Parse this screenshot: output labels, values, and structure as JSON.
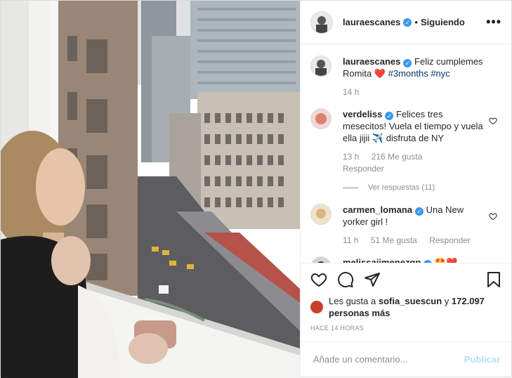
{
  "post": {
    "username": "lauraescanes",
    "follow_sep": "•",
    "follow_label": "Siguiendo",
    "more_label": "•••"
  },
  "caption": {
    "username": "lauraescanes",
    "text": "Feliz cumplemes Romita",
    "emoji": "❤️",
    "tags": "#3months #nyc",
    "time": "14 h"
  },
  "comments": [
    {
      "username": "verdeliss",
      "text": "Felices tres mesecitos! Vuela el tiempo y vuela ella jijii",
      "emoji": "✈️",
      "text2": "disfruta de NY",
      "time": "13 h",
      "likes": "216 Me gusta",
      "reply": "Responder",
      "view_replies": "Ver respuestas (11)"
    },
    {
      "username": "carmen_lomana",
      "text": "Una New yorker girl !",
      "time": "11 h",
      "likes": "51 Me gusta",
      "reply": "Responder"
    },
    {
      "username": "melissajimenezgp",
      "text": "🤩❤️"
    }
  ],
  "likes": {
    "prefix": "Les gusta a",
    "user": "sofia_suescun",
    "suffix": "y",
    "count": "172.097 personas más"
  },
  "posted_ago": "HACE 14 HORAS",
  "add_comment": {
    "placeholder": "Añade un comentario...",
    "publish": "Publicar"
  },
  "colors": {
    "verified": "#3897f0",
    "link": "#00376b",
    "publish_disabled": "#b2dffc"
  }
}
